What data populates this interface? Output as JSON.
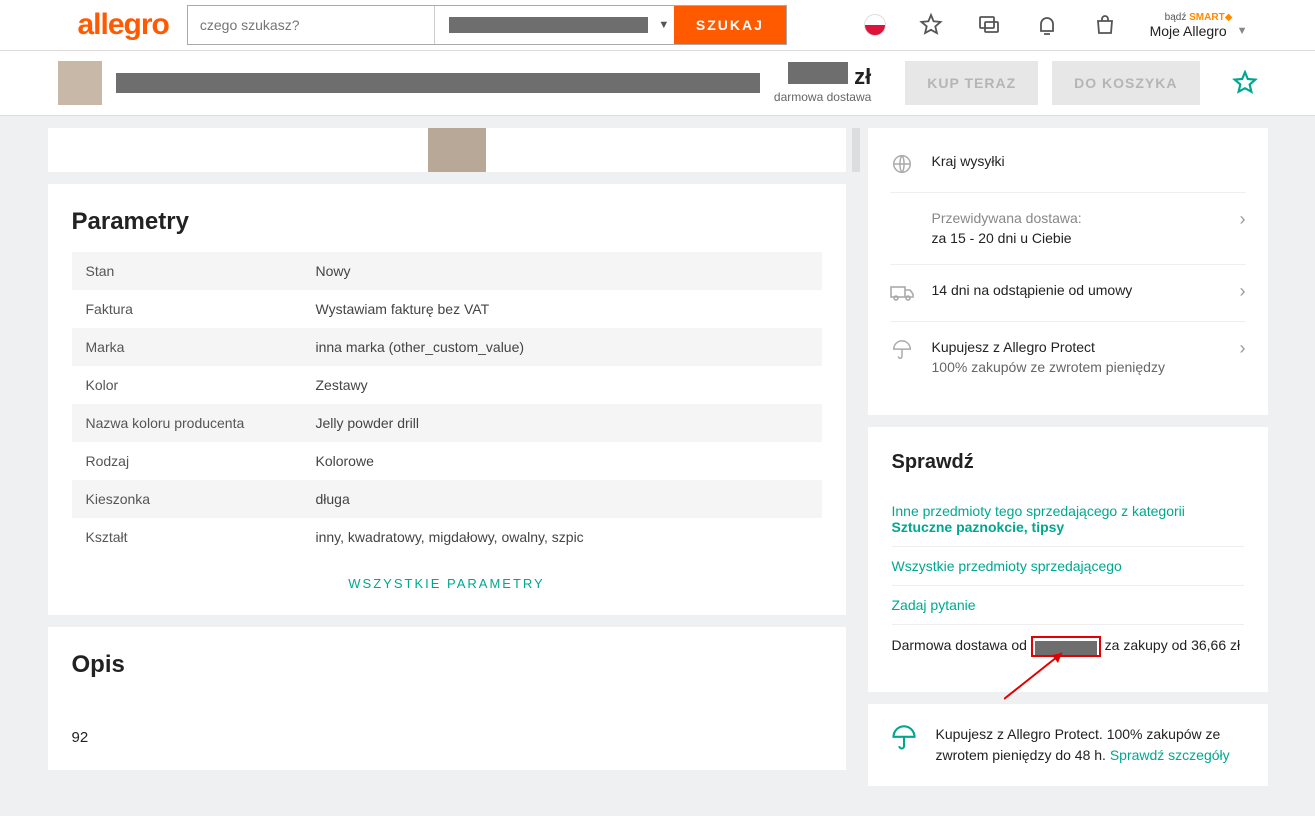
{
  "header": {
    "logo": "allegro",
    "search_placeholder": "czego szukasz?",
    "search_button": "SZUKAJ",
    "smart_prefix": "bądź ",
    "smart_label": "SMART",
    "account_label": "Moje Allegro"
  },
  "sticky": {
    "currency": "zł",
    "free_shipping": "darmowa dostawa",
    "buy_now": "KUP TERAZ",
    "add_cart": "DO KOSZYKA"
  },
  "params": {
    "title": "Parametry",
    "rows": [
      {
        "k": "Stan",
        "v": "Nowy",
        "link": false
      },
      {
        "k": "Faktura",
        "v": "Wystawiam fakturę bez VAT",
        "link": false
      },
      {
        "k": "Marka",
        "v": "inna marka (other_custom_value)",
        "link": true
      },
      {
        "k": "Kolor",
        "v": "Zestawy",
        "link": false
      },
      {
        "k": "Nazwa koloru producenta",
        "v": "Jelly powder drill",
        "link": false
      },
      {
        "k": "Rodzaj",
        "v": "Kolorowe",
        "link": true
      },
      {
        "k": "Kieszonka",
        "v": "długa",
        "link": false
      },
      {
        "k": "Kształt",
        "v": "inny, kwadratowy, migdałowy, owalny, szpic",
        "link": false
      }
    ],
    "all": "WSZYSTKIE PARAMETRY"
  },
  "desc": {
    "title": "Opis",
    "body": "92"
  },
  "info": {
    "country_label": "Kraj wysyłki",
    "delivery_label": "Przewidywana dostawa:",
    "delivery_value": "za 15 - 20 dni u Ciebie",
    "return_label": "14 dni na odstąpienie od umowy",
    "protect_label": "Kupujesz z Allegro Protect",
    "protect_sub": "100% zakupów ze zwrotem pieniędzy"
  },
  "check": {
    "title": "Sprawdź",
    "other_items": "Inne przedmioty tego sprzedającego z kategorii",
    "category": "Sztuczne paznokcie, tipsy",
    "all_items": "Wszystkie przedmioty sprzedającego",
    "ask": "Zadaj pytanie",
    "freeship_before": "Darmowa dostawa od ",
    "freeship_after": " za zakupy od 36,66 zł"
  },
  "protect_box": {
    "text": "Kupujesz z Allegro Protect. 100% zakupów ze zwrotem pieniędzy do 48 h. ",
    "link": "Sprawdź szczegóły"
  }
}
